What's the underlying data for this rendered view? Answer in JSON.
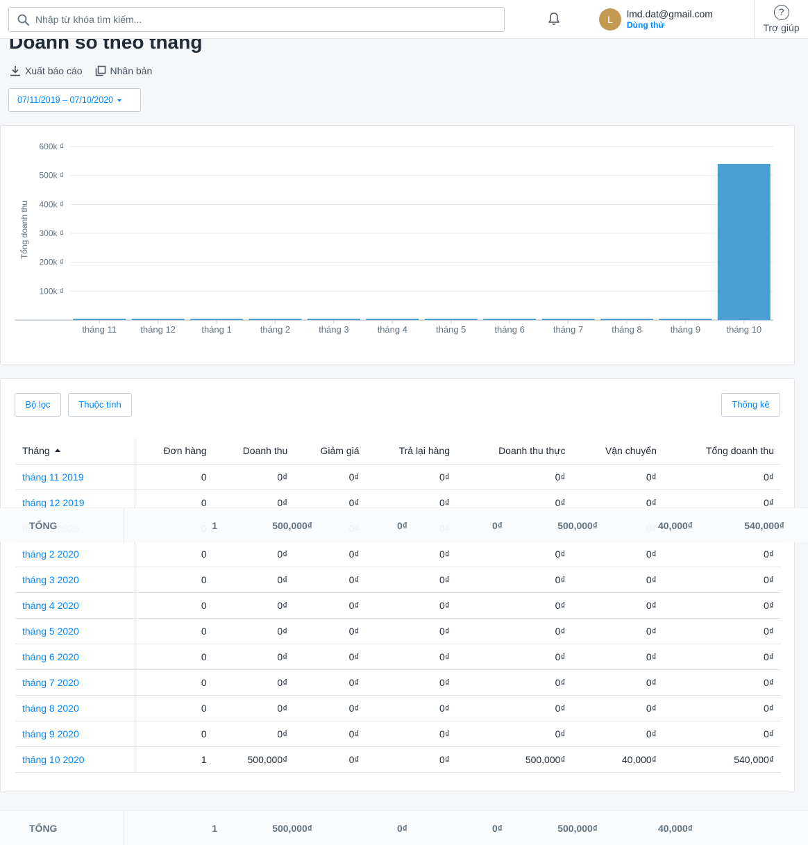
{
  "topbar": {
    "search_placeholder": "Nhập từ khóa tìm kiếm...",
    "avatar_initial": "L",
    "user_email": "lmd.dat@gmail.com",
    "user_plan": "Dùng thử",
    "help_label": "Trợ giúp",
    "help_symbol": "?"
  },
  "header": {
    "title": "Doanh số theo tháng",
    "export_label": "Xuất báo cáo",
    "duplicate_label": "Nhân bản",
    "date_range": "07/11/2019 – 07/10/2020"
  },
  "colors": {
    "accent": "#0088ff",
    "bar": "#4a9fd5"
  },
  "chart_data": {
    "type": "bar",
    "ylabel": "Tổng doanh thu",
    "ylim": [
      0,
      600000
    ],
    "yticks": [
      100000,
      200000,
      300000,
      400000,
      500000,
      600000
    ],
    "ytick_labels": [
      "100k ₫",
      "200k ₫",
      "300k ₫",
      "400k ₫",
      "500k ₫",
      "600k ₫"
    ],
    "categories": [
      "tháng 11",
      "tháng 12",
      "tháng 1",
      "tháng 2",
      "tháng 3",
      "tháng 4",
      "tháng 5",
      "tháng 6",
      "tháng 7",
      "tháng 8",
      "tháng 9",
      "tháng 10"
    ],
    "values": [
      0,
      0,
      0,
      0,
      0,
      0,
      0,
      0,
      0,
      0,
      0,
      540000
    ],
    "grid": true
  },
  "table": {
    "buttons": {
      "filter": "Bộ lọc",
      "attributes": "Thuộc tính",
      "stats": "Thống kê"
    },
    "columns": [
      "Tháng",
      "Đơn hàng",
      "Doanh thu",
      "Giảm giá",
      "Trả lại hàng",
      "Doanh thu thực",
      "Vận chuyển",
      "Tổng doanh thu"
    ],
    "rows": [
      [
        "tháng 11 2019",
        "0",
        "0₫",
        "0₫",
        "0₫",
        "0₫",
        "0₫",
        "0₫"
      ],
      [
        "tháng 12 2019",
        "0",
        "0₫",
        "0₫",
        "0₫",
        "0₫",
        "0₫",
        "0₫"
      ],
      [
        "tháng 1 2020",
        "0",
        "0₫",
        "0₫",
        "0₫",
        "0₫",
        "0₫",
        "0₫"
      ],
      [
        "tháng 2 2020",
        "0",
        "0₫",
        "0₫",
        "0₫",
        "0₫",
        "0₫",
        "0₫"
      ],
      [
        "tháng 3 2020",
        "0",
        "0₫",
        "0₫",
        "0₫",
        "0₫",
        "0₫",
        "0₫"
      ],
      [
        "tháng 4 2020",
        "0",
        "0₫",
        "0₫",
        "0₫",
        "0₫",
        "0₫",
        "0₫"
      ],
      [
        "tháng 5 2020",
        "0",
        "0₫",
        "0₫",
        "0₫",
        "0₫",
        "0₫",
        "0₫"
      ],
      [
        "tháng 6 2020",
        "0",
        "0₫",
        "0₫",
        "0₫",
        "0₫",
        "0₫",
        "0₫"
      ],
      [
        "tháng 7 2020",
        "0",
        "0₫",
        "0₫",
        "0₫",
        "0₫",
        "0₫",
        "0₫"
      ],
      [
        "tháng 8 2020",
        "0",
        "0₫",
        "0₫",
        "0₫",
        "0₫",
        "0₫",
        "0₫"
      ],
      [
        "tháng 9 2020",
        "0",
        "0₫",
        "0₫",
        "0₫",
        "0₫",
        "0₫",
        "0₫"
      ],
      [
        "tháng 10 2020",
        "1",
        "500,000₫",
        "0₫",
        "0₫",
        "500,000₫",
        "40,000₫",
        "540,000₫"
      ]
    ]
  },
  "totals": {
    "label": "TỔNG",
    "orders": "1",
    "revenue": "500,000₫",
    "discount": "0₫",
    "returns": "0₫",
    "net_revenue": "500,000₫",
    "shipping": "40,000₫",
    "total_revenue": "540,000₫"
  }
}
